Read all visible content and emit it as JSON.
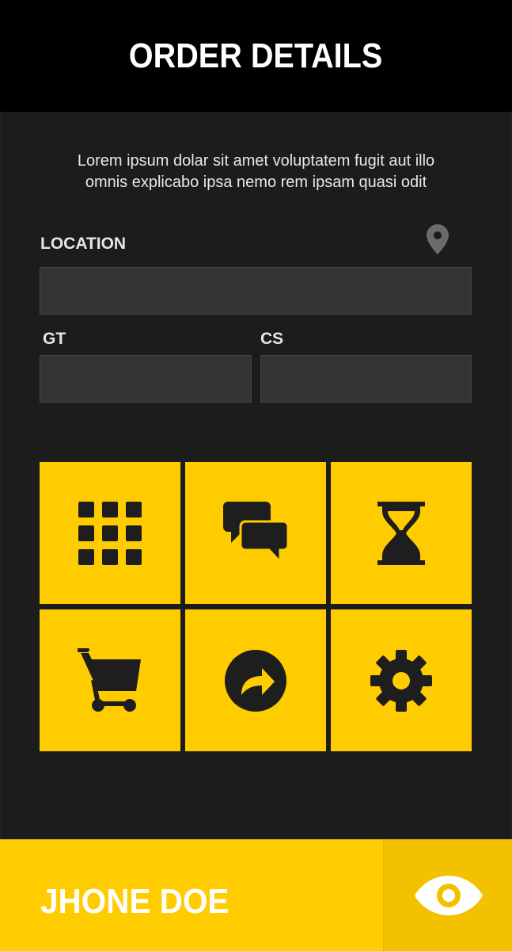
{
  "header": {
    "title": "ORDER DETAILS"
  },
  "description": {
    "line1": "Lorem ipsum dolar sit amet voluptatem fugit aut illo",
    "line2": "omnis explicabo ipsa nemo rem ipsam quasi odit"
  },
  "form": {
    "location_label": "LOCATION",
    "location_value": "",
    "gt_label": "GT",
    "gt_value": "",
    "cs_label": "CS",
    "cs_value": ""
  },
  "tiles": [
    {
      "icon": "grid-icon"
    },
    {
      "icon": "chat-icon"
    },
    {
      "icon": "hourglass-icon"
    },
    {
      "icon": "cart-icon"
    },
    {
      "icon": "share-icon"
    },
    {
      "icon": "gear-icon"
    }
  ],
  "footer": {
    "user_name": "JHONE DOE",
    "view_icon": "eye-icon"
  },
  "colors": {
    "accent": "#ffcc00",
    "header_bg": "#000000",
    "body_bg": "#1c1c1c",
    "field_bg": "#333333"
  }
}
